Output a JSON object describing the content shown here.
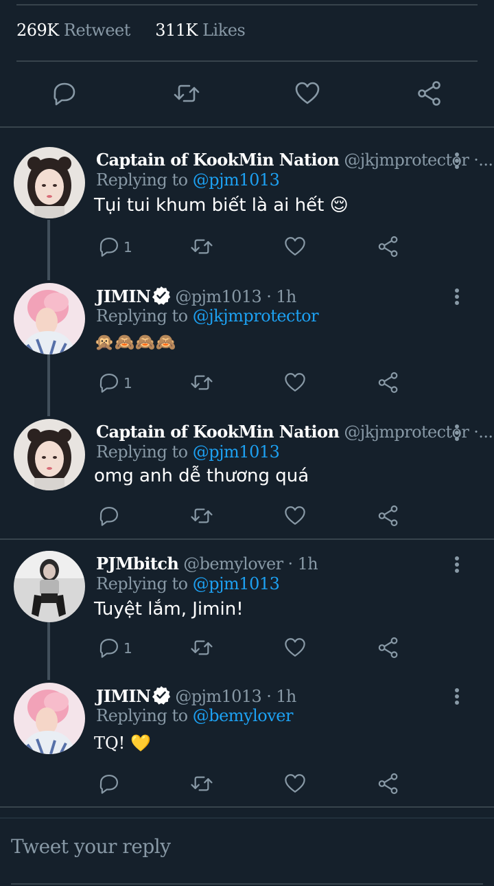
{
  "stats": {
    "retweets_count": "269K",
    "retweets_label": "Retweet",
    "likes_count": "311K",
    "likes_label": "Likes"
  },
  "colors": {
    "background": "#15202b",
    "divider": "#38444d",
    "muted": "#8899a6",
    "link": "#1da1f2",
    "text": "#ffffff"
  },
  "tweets": [
    {
      "name": "Captain of KookMin Nation",
      "handle": "@jkjmprotector ·...",
      "replying_label": "Replying to",
      "replying_to": "@pjm1013",
      "text": "Tụi tui khum biết là ai hết 😌",
      "reply_count": "1",
      "avatar": "avatar-girl"
    },
    {
      "name": "JIMIN",
      "verified": true,
      "handle": "@pjm1013 · 1h",
      "replying_label": "Replying to",
      "replying_to": "@jkjmprotector",
      "text": "🙊🙈🙈🙈",
      "reply_count": "1",
      "avatar": "avatar-pink-hair"
    },
    {
      "name": "Captain of KookMin Nation",
      "handle": "@jkjmprotector ·...",
      "replying_label": "Replying to",
      "replying_to": "@pjm1013",
      "text": "omg anh dễ thương quá",
      "reply_count": "",
      "avatar": "avatar-girl"
    },
    {
      "name": "PJMbitch",
      "handle": "@bemylover · 1h",
      "replying_label": "Replying to",
      "replying_to": "@pjm1013",
      "text": "Tuyệt lắm, Jimin!",
      "reply_count": "1",
      "avatar": "avatar-girl-bw"
    },
    {
      "name": "JIMIN",
      "verified": true,
      "handle": "@pjm1013 · 1h",
      "replying_label": "Replying to",
      "replying_to": "@bemylover",
      "text": "TQ! 💛",
      "reply_count": "",
      "avatar": "avatar-pink-hair"
    }
  ],
  "composer": {
    "placeholder": "Tweet your reply"
  },
  "icons": [
    "reply-icon",
    "retweet-icon",
    "like-icon",
    "share-icon",
    "more-icon",
    "verified-badge-icon"
  ]
}
